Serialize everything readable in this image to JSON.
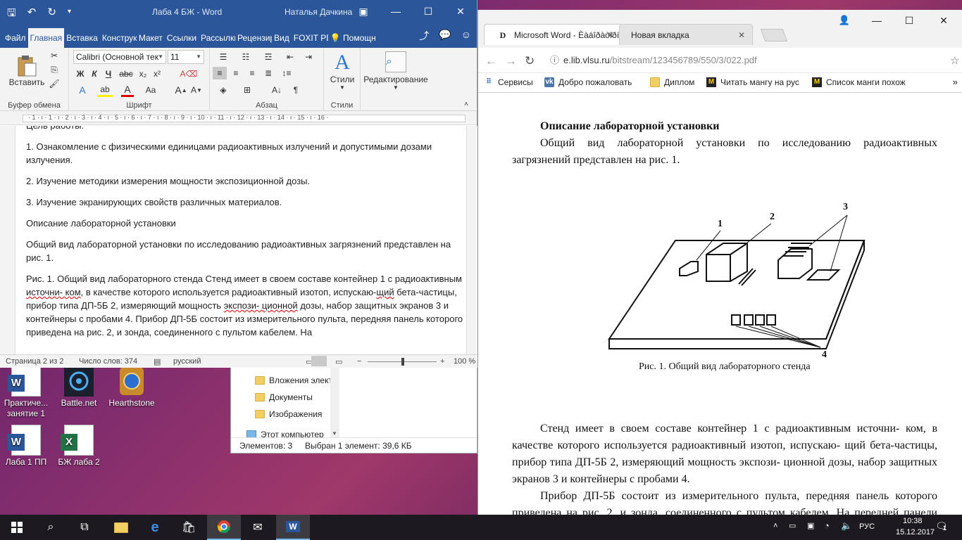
{
  "desktop": {
    "icons": [
      {
        "label": "Практиче... занятие 1",
        "type": "word"
      },
      {
        "label": "Battle.net",
        "type": "battlenet"
      },
      {
        "label": "Hearthstone",
        "type": "hearthstone"
      },
      {
        "label": "Лаба 1 ПП",
        "type": "word"
      },
      {
        "label": "БЖ лаба 2",
        "type": "excel"
      }
    ]
  },
  "word": {
    "title": "Лаба 4 БЖ  -  Word",
    "user": "Наталья Дачкина",
    "tabs": [
      "Файл",
      "Главная",
      "Вставка",
      "Конструктор",
      "Макет",
      "Ссылки",
      "Рассылки",
      "Рецензирование",
      "Вид",
      "FOXIT PDF"
    ],
    "active_tab": "Главная",
    "tell_me": "Помощн",
    "ribbon": {
      "paste": "Вставить",
      "clipboard": "Буфер обмена",
      "font_name": "Calibri (Основной тек",
      "font_size": "11",
      "font_group": "Шрифт",
      "paragraph_group": "Абзац",
      "styles": "Стили",
      "styles_group": "Стили",
      "editing": "Редактирование"
    },
    "ruler_numbers": "· 1 · ı · 1 · ı · 2 · ı · 3 · ı · 4 · ı · 5 · ı · 6 · ı · 7 · ı · 8 · ı · 9 · ı · 10 · ı · 11 · ı · 12 · ı · 13 · ı · 14 · ı · 15 · ı · 16 ·",
    "doc": {
      "p0": "Цель работы:",
      "p1": "1. Ознакомление с физическими единицами радиоактивных излучений и допустимыми дозами излучения.",
      "p2": "2. Изучение методики измерения мощности экспозиционной дозы.",
      "p3": "3. Изучение экранирующих свойств различных материалов.",
      "p4": "Описание лабораторной установки",
      "p5": " Общий вид лабораторной установки по исследованию радиоактивных загрязнений представлен на рис. 1.",
      "p6a": " Рис. 1. Общий вид лабораторного стенда Стенд имеет в своем составе контейнер 1 с радиоактивным ",
      "p6b": "источни- ком",
      "p6c": ", в качестве которого используется радиоактивный изотоп, испускаю-",
      "p6d": "щий",
      "p6e": " бета-частицы, прибор типа ДП-5Б 2, измеряющий мощность ",
      "p6f": "экспози- ционной",
      "p6g": " дозы, набор защитных экранов 3 и контейнеры с пробами 4. Прибор ДП-5Б состоит из измерительного пульта, передняя панель которого приведена на рис. 2, и зонда, соединенного с пультом кабелем. На"
    },
    "status": {
      "page": "Страница 2 из 2",
      "words": "Число слов: 374",
      "lang": "русский",
      "zoom": "100 %"
    }
  },
  "explorer": {
    "items": [
      "Вложения элект",
      "Документы",
      "Изображения",
      "Этот компьютер"
    ],
    "status_count": "Элементов: 3",
    "status_selected": "Выбран 1 элемент: 39,6 КБ"
  },
  "chrome": {
    "tabs": [
      {
        "title": "Microsoft Word - Èàáîðàòîðíàÿ",
        "active": true
      },
      {
        "title": "Новая вкладка",
        "active": false
      }
    ],
    "url_host": "e.lib.vlsu.ru",
    "url_path": "/bitstream/123456789/550/3/022.pdf",
    "bookmarks": [
      "Сервисы",
      "Добро пожаловать",
      "Диплом",
      "Читать мангу на рус",
      "Список манги похож"
    ],
    "pdf": {
      "heading": "Описание лабораторной установки",
      "para1": "Общий вид лабораторной установки по исследованию радиоактивных загрязнений представлен на рис. 1.",
      "caption": "Рис. 1. Общий вид лабораторного стенда",
      "labels": [
        "1",
        "2",
        "3",
        "4"
      ],
      "para2": "Стенд имеет в своем составе контейнер 1 с радиоактивным источни- ком, в качестве которого используется радиоактивный изотоп, испускаю- щий бета-частицы, прибор типа ДП-5Б 2, измеряющий мощность экспози- ционной дозы, набор защитных экранов 3 и контейнеры с пробами 4.",
      "para3": "Прибор ДП-5Б состоит из измерительного пульта, передняя панель которого приведена на рис. 2, и зонда, соединенного с пультом кабелем. На передней панели измерительного пульта расположены отдельный"
    }
  },
  "taskbar": {
    "lang": "РУС",
    "time": "10:38",
    "date": "15.12.2017",
    "notifications": "1"
  }
}
